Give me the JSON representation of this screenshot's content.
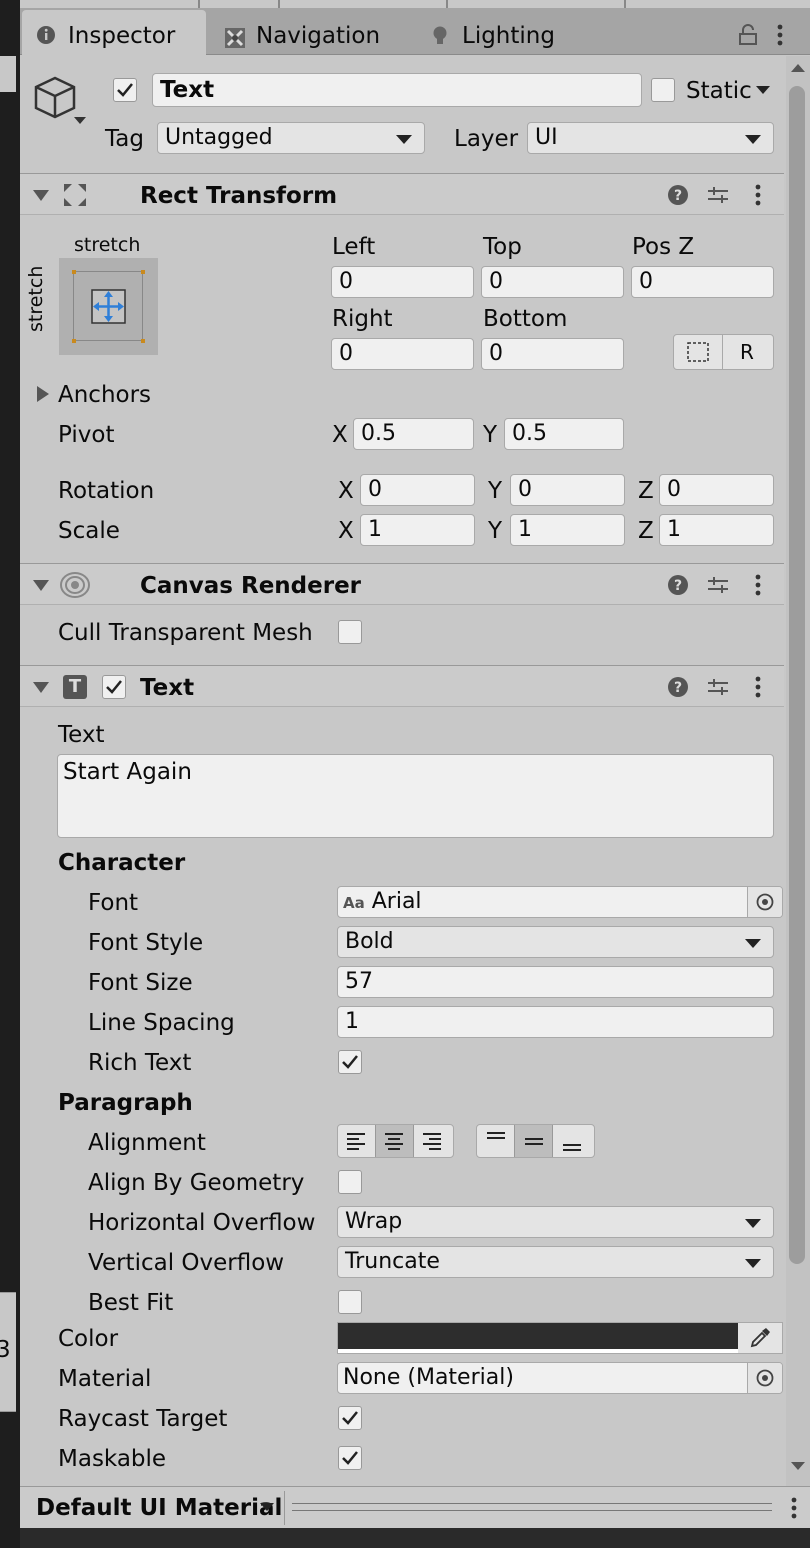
{
  "tabs": [
    {
      "label": "Inspector"
    },
    {
      "label": "Navigation"
    },
    {
      "label": "Lighting"
    }
  ],
  "gameobject": {
    "name": "Text",
    "static_label": "Static",
    "tag_label": "Tag",
    "tag_value": "Untagged",
    "layer_label": "Layer",
    "layer_value": "UI"
  },
  "rect_transform": {
    "title": "Rect Transform",
    "anchor_preset_top": "stretch",
    "anchor_preset_side": "stretch",
    "labels": {
      "left": "Left",
      "top": "Top",
      "posz": "Pos Z",
      "right": "Right",
      "bottom": "Bottom"
    },
    "values": {
      "left": "0",
      "top": "0",
      "posz": "0",
      "right": "0",
      "bottom": "0"
    },
    "anchors_label": "Anchors",
    "pivot_label": "Pivot",
    "pivot": {
      "x": "0.5",
      "y": "0.5"
    },
    "rotation_label": "Rotation",
    "rotation": {
      "x": "0",
      "y": "0",
      "z": "0"
    },
    "scale_label": "Scale",
    "scale": {
      "x": "1",
      "y": "1",
      "z": "1"
    },
    "axis": {
      "x": "X",
      "y": "Y",
      "z": "Z"
    }
  },
  "canvas_renderer": {
    "title": "Canvas Renderer",
    "cull_label": "Cull Transparent Mesh"
  },
  "text_component": {
    "title": "Text",
    "text_label": "Text",
    "text_value": "Start Again",
    "character_header": "Character",
    "font_label": "Font",
    "font_icon_text": "Aa",
    "font_value": "Arial",
    "font_style_label": "Font Style",
    "font_style_value": "Bold",
    "font_size_label": "Font Size",
    "font_size_value": "57",
    "line_spacing_label": "Line Spacing",
    "line_spacing_value": "1",
    "rich_text_label": "Rich Text",
    "paragraph_header": "Paragraph",
    "alignment_label": "Alignment",
    "align_by_geometry_label": "Align By Geometry",
    "h_overflow_label": "Horizontal Overflow",
    "h_overflow_value": "Wrap",
    "v_overflow_label": "Vertical Overflow",
    "v_overflow_value": "Truncate",
    "best_fit_label": "Best Fit",
    "color_label": "Color",
    "color_value": "#2d2d2d",
    "material_label": "Material",
    "material_value": "None (Material)",
    "raycast_label": "Raycast Target",
    "maskable_label": "Maskable"
  },
  "footer": {
    "material_label": "Default UI Material"
  },
  "left_edge": {
    "partial_text": "3"
  },
  "colors": {
    "panel": "#c8c8c8",
    "header": "#cbcbcb",
    "field": "#f0f0f0",
    "accent_blue": "#2f7fd8"
  }
}
